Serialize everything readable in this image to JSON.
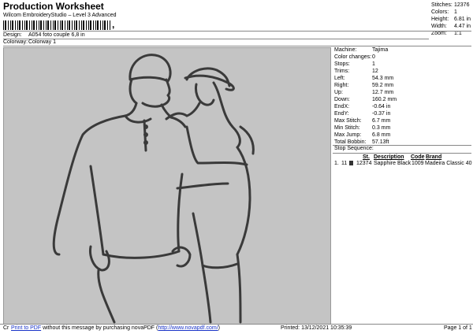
{
  "header": {
    "title": "Production Worksheet",
    "subtitle": "Wilcom EmbroideryStudio – Level 3 Advanced",
    "barcode_suffix": ",",
    "design_label": "Design:",
    "design_value": "A054 foto couple 6,8 in",
    "colorway_label": "Colorway:",
    "colorway_value": "Colorway 1"
  },
  "stats_right": [
    {
      "label": "Stitches:",
      "value": "12376"
    },
    {
      "label": "Colors:",
      "value": "1"
    },
    {
      "label": "Height:",
      "value": "6.81 in"
    },
    {
      "label": "Width:",
      "value": "4.47 in"
    },
    {
      "label": "Zoom:",
      "value": "1:1"
    }
  ],
  "info": [
    {
      "label": "Machine:",
      "value": "Tajima"
    },
    {
      "label": "Color changes:",
      "value": "0"
    },
    {
      "label": "Stops:",
      "value": "1"
    },
    {
      "label": "Trims:",
      "value": "12"
    },
    {
      "label": "Left:",
      "value": "54.3 mm"
    },
    {
      "label": "Right:",
      "value": "59.2 mm"
    },
    {
      "label": "Up:",
      "value": "12.7 mm"
    },
    {
      "label": "Down:",
      "value": "160.2 mm"
    },
    {
      "label": "EndX:",
      "value": "-0.64 in"
    },
    {
      "label": "EndY:",
      "value": "-0.37 in"
    },
    {
      "label": "Max Stitch:",
      "value": "6.7 mm"
    },
    {
      "label": "Min Stitch:",
      "value": "0.3 mm"
    },
    {
      "label": "Max Jump:",
      "value": "6.8 mm"
    },
    {
      "label": "Total Bobbin:",
      "value": "57.13ft"
    }
  ],
  "stop_sequence": {
    "heading": "Stop Sequence:",
    "columns": {
      "st": "St.",
      "description": "Description",
      "code": "Code",
      "brand": "Brand"
    },
    "row": {
      "index": "1.",
      "stop": "11",
      "st": "12374",
      "description": "Sapphire Black",
      "code": "1009",
      "brand": "Madeira Classic 40"
    },
    "swatch_color": "#333333"
  },
  "footer": {
    "prefix": "Cr",
    "link1": "Print to PDF",
    "middle": " without this message by purchasing novaPDF (",
    "link2": "http://www.novapdf.com/",
    "suffix": ")",
    "printed": "Printed: 13/12/2021 10:35:39",
    "page": "Page 1 of 1"
  },
  "colors": {
    "canvas": "#c4c4c4",
    "stitch": "#3a3a3a",
    "link": "#1a34c8"
  }
}
